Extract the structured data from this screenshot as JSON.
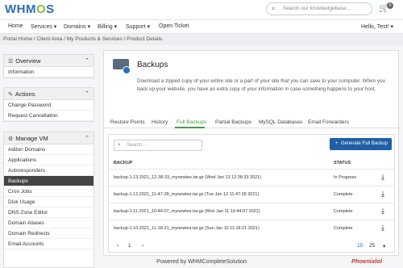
{
  "header": {
    "logo_prefix": "WHM",
    "logo_o": "O",
    "logo_suffix": "S",
    "search_placeholder": "Search our knowledgebase...",
    "cart_count": "0"
  },
  "nav": {
    "items": [
      "Home",
      "Services ▾",
      "Domains ▾",
      "Billing ▾",
      "Support ▾",
      "Open Ticket"
    ],
    "user": "Hello, Test! ▾"
  },
  "breadcrumb": "Portal Home / Client Area / My Products & Services / Product Details",
  "sidebar": {
    "overview": {
      "title": "Overview",
      "items": [
        "Information"
      ]
    },
    "actions": {
      "title": "Actions",
      "items": [
        "Change Password",
        "Request Cancellation"
      ]
    },
    "manage": {
      "title": "Manage VM",
      "items": [
        "Addon Domains",
        "Applications",
        "Autoresponders",
        "Backups",
        "Cron Jobs",
        "Disk Usage",
        "DNS Zone Editor",
        "Domain Aliases",
        "Domain Redirects",
        "Email Accounts"
      ]
    }
  },
  "main": {
    "title": "Backups",
    "description": "Download a zipped copy of your entire site or a part of your site that you can save to your computer. When you back up your website, you have an extra copy of your information in case something happens to your host.",
    "tabs": [
      "Restore Points",
      "History",
      "Full Backups",
      "Partial Backups",
      "MySQL Databases",
      "Email Forwarders"
    ],
    "active_tab": "Full Backups",
    "search_placeholder": "Search...",
    "generate_button": "Generate Full Backup",
    "columns": [
      "BACKUP",
      "STATUS"
    ],
    "rows": [
      {
        "name": "backup-1.13.2021_12-38-33_mynewtes.tar.gz (Wed Jan 13 12:38:33 2021)",
        "status": "In Progress"
      },
      {
        "name": "backup-1.12.2021_11-47-28_mynewtes.tar.gz (Tue Jan 12 11:47:28 2021)",
        "status": "Complete"
      },
      {
        "name": "backup-1.11.2021_10-44-07_mynewtes.tar.gz (Mon Jan 11 10:44:07 2021)",
        "status": "Complete"
      },
      {
        "name": "backup-1.10.2021_11-18-21_mynewtes.tar.gz (Sun Jan 10 11:18:21 2021)",
        "status": "Complete"
      }
    ],
    "pager": {
      "prev": "‹",
      "page": "1",
      "next": "›",
      "size_a": "10",
      "size_b": "25",
      "more": "▾"
    }
  },
  "footer": "Powered by WHMCompleteSolution",
  "watermark": "Phoenixlol"
}
